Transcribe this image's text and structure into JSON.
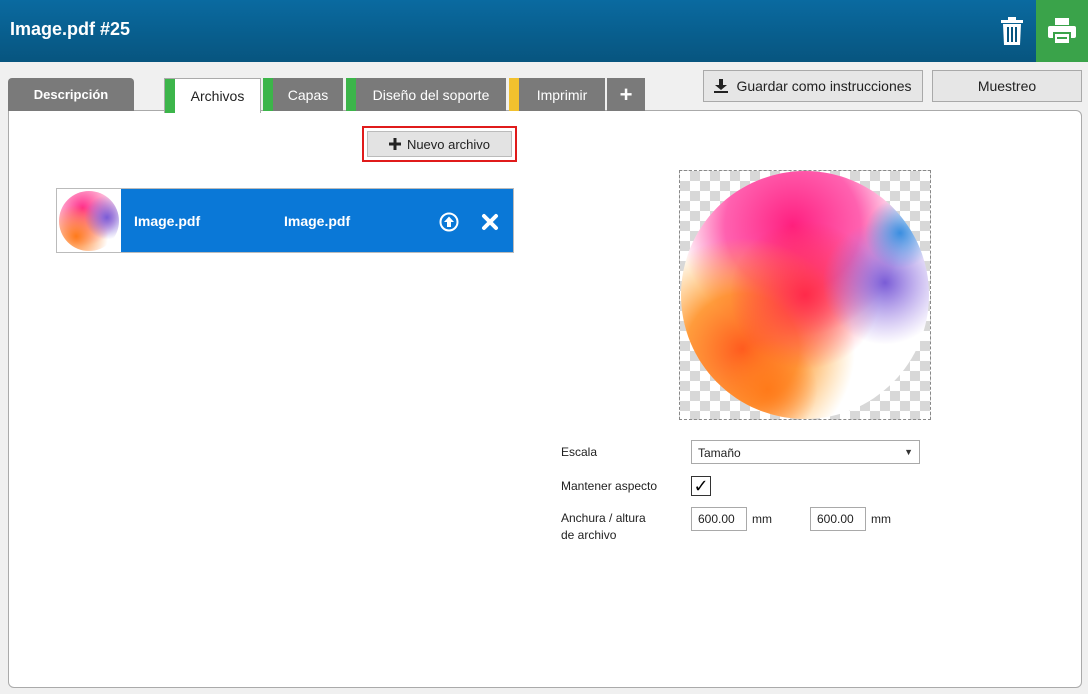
{
  "window": {
    "title": "Image.pdf #25"
  },
  "header": {
    "trash_icon": "trash-icon",
    "print_icon": "printer-icon",
    "print_bg": "#3aa34a"
  },
  "tabs": [
    {
      "label": "Descripción",
      "stripe": ""
    },
    {
      "label": "Archivos",
      "stripe": "#3cb54a",
      "active": true
    },
    {
      "label": "Capas",
      "stripe": "#3cb54a"
    },
    {
      "label": "Diseño del soporte",
      "stripe": "#3cb54a"
    },
    {
      "label": "Imprimir",
      "stripe": "#f2c12e"
    },
    {
      "label": "+",
      "stripe": ""
    }
  ],
  "toolbar": {
    "save_label": "Guardar como instrucciones",
    "sample_label": "Muestreo"
  },
  "files": {
    "new_label": "Nuevo archivo",
    "items": [
      {
        "name": "Image.pdf",
        "file": "Image.pdf"
      }
    ],
    "selected_color": "#0a78d7"
  },
  "settings": {
    "scale_label": "Escala",
    "scale_value": "Tamaño",
    "aspect_label": "Mantener aspecto",
    "aspect_checked": "✓",
    "size_label_1": "Anchura / altura",
    "size_label_2": "de archivo",
    "width_value": "600.00",
    "height_value": "600.00",
    "unit": "mm"
  }
}
